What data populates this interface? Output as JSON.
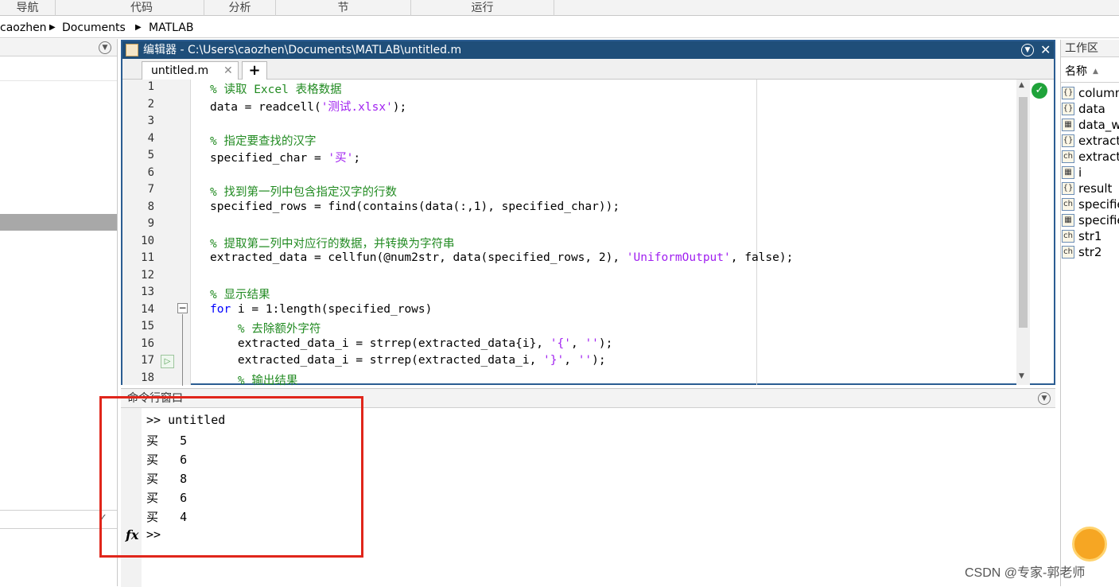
{
  "ribbon": {
    "tabs": [
      "导航",
      "代码",
      "分析",
      "节",
      "运行"
    ]
  },
  "address": {
    "crumbs": [
      "caozhen",
      "Documents",
      "MATLAB"
    ]
  },
  "editor": {
    "title": "编辑器 - C:\\Users\\caozhen\\Documents\\MATLAB\\untitled.m",
    "tab_label": "untitled.m",
    "add_tab": "+",
    "lines": [
      {
        "n": "1",
        "parts": [
          {
            "c": "cm",
            "t": "% 读取 Excel 表格数据"
          }
        ]
      },
      {
        "n": "2",
        "parts": [
          {
            "c": "tx",
            "t": "data = readcell("
          },
          {
            "c": "st",
            "t": "'测试.xlsx'"
          },
          {
            "c": "tx",
            "t": ");"
          }
        ]
      },
      {
        "n": "3",
        "parts": []
      },
      {
        "n": "4",
        "parts": [
          {
            "c": "cm",
            "t": "% 指定要查找的汉字"
          }
        ]
      },
      {
        "n": "5",
        "parts": [
          {
            "c": "tx",
            "t": "specified_char = "
          },
          {
            "c": "st",
            "t": "'买'"
          },
          {
            "c": "tx",
            "t": ";"
          }
        ]
      },
      {
        "n": "6",
        "parts": []
      },
      {
        "n": "7",
        "parts": [
          {
            "c": "cm",
            "t": "% 找到第一列中包含指定汉字的行数"
          }
        ]
      },
      {
        "n": "8",
        "parts": [
          {
            "c": "tx",
            "t": "specified_rows = find(contains(data(:,1), specified_char));"
          }
        ]
      },
      {
        "n": "9",
        "parts": []
      },
      {
        "n": "10",
        "parts": [
          {
            "c": "cm",
            "t": "% 提取第二列中对应行的数据，并转换为字符串"
          }
        ]
      },
      {
        "n": "11",
        "parts": [
          {
            "c": "tx",
            "t": "extracted_data = cellfun(@num2str, data(specified_rows, 2), "
          },
          {
            "c": "st",
            "t": "'UniformOutput'"
          },
          {
            "c": "tx",
            "t": ", false);"
          }
        ]
      },
      {
        "n": "12",
        "parts": []
      },
      {
        "n": "13",
        "parts": [
          {
            "c": "cm",
            "t": "% 显示结果"
          }
        ]
      },
      {
        "n": "14",
        "parts": [
          {
            "c": "kw",
            "t": "for"
          },
          {
            "c": "tx",
            "t": " i = 1:length(specified_rows)"
          }
        ]
      },
      {
        "n": "15",
        "parts": [
          {
            "c": "cm",
            "t": "    % 去除额外字符"
          }
        ]
      },
      {
        "n": "16",
        "parts": [
          {
            "c": "tx",
            "t": "    extracted_data_i = strrep(extracted_data{i}, "
          },
          {
            "c": "st",
            "t": "'{'"
          },
          {
            "c": "tx",
            "t": ", "
          },
          {
            "c": "st",
            "t": "''"
          },
          {
            "c": "tx",
            "t": ");"
          }
        ]
      },
      {
        "n": "17",
        "parts": [
          {
            "c": "tx",
            "t": "    extracted_data_i = strrep(extracted_data_i, "
          },
          {
            "c": "st",
            "t": "'}'"
          },
          {
            "c": "tx",
            "t": ", "
          },
          {
            "c": "st",
            "t": "''"
          },
          {
            "c": "tx",
            "t": ");"
          }
        ]
      },
      {
        "n": "18",
        "parts": [
          {
            "c": "cm",
            "t": "    % 输出结果"
          }
        ]
      }
    ]
  },
  "command": {
    "title": "命令行窗口",
    "lines": [
      ">> untitled",
      "买   5",
      "买   6",
      "买   8",
      "买   6",
      "买   4",
      ">>"
    ],
    "fx": "fx"
  },
  "workspace": {
    "title": "工作区",
    "header": "名称",
    "items": [
      {
        "name": "column",
        "icon": "{}"
      },
      {
        "name": "data",
        "icon": "{}"
      },
      {
        "name": "data_w",
        "icon": "▦"
      },
      {
        "name": "extract",
        "icon": "{}"
      },
      {
        "name": "extract",
        "icon": "ch"
      },
      {
        "name": "i",
        "icon": "▦"
      },
      {
        "name": "result",
        "icon": "{}"
      },
      {
        "name": "specifie",
        "icon": "ch"
      },
      {
        "name": "specifie",
        "icon": "▦"
      },
      {
        "name": "str1",
        "icon": "ch"
      },
      {
        "name": "str2",
        "icon": "ch"
      }
    ]
  },
  "watermark": "CSDN @专家-郭老师",
  "colors": {
    "editor_title": "#1f4e79",
    "comment": "#228b22",
    "keyword": "#0000ff",
    "string": "#a020f0",
    "highlight_box": "#e0261b"
  }
}
